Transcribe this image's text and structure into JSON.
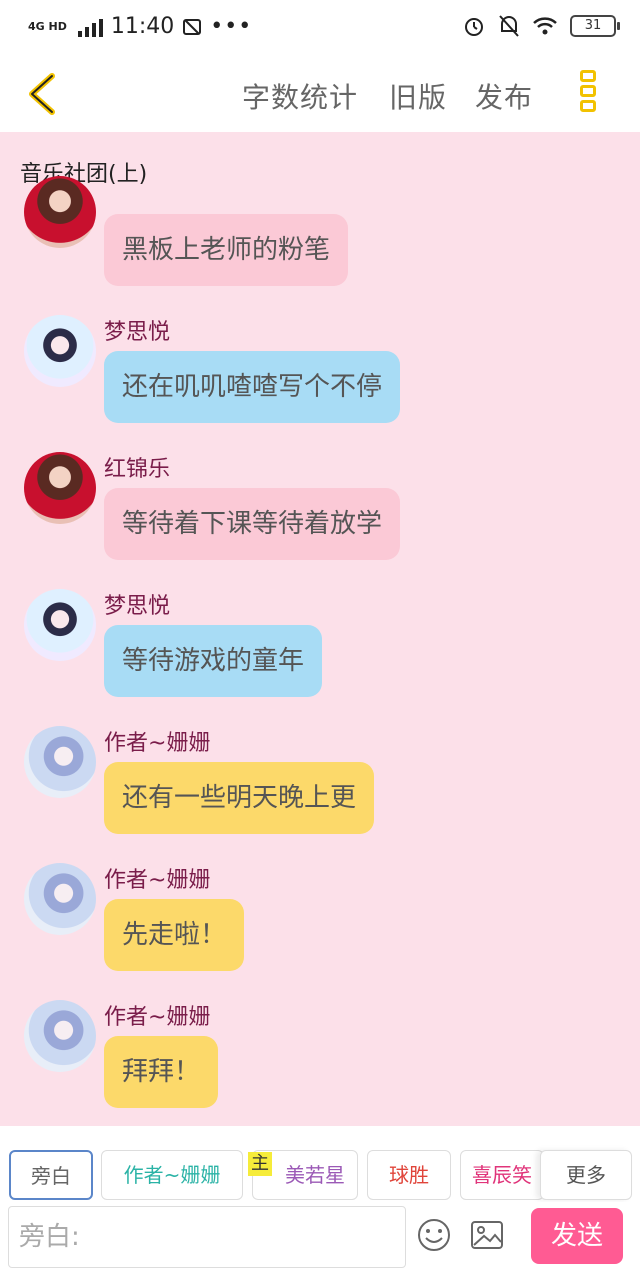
{
  "status_bar": {
    "network": "4G HD",
    "time": "11:40",
    "battery": "31"
  },
  "header": {
    "word_count": "字数统计",
    "old_version": "旧版",
    "publish": "发布"
  },
  "chat": {
    "title": "音乐社团(上)",
    "messages": [
      {
        "name": "",
        "text": "黑板上老师的粉笔",
        "style": "pink",
        "avatar": "red"
      },
      {
        "name": "梦思悦",
        "text": "还在叽叽喳喳写个不停",
        "style": "blue",
        "avatar": "blue"
      },
      {
        "name": "红锦乐",
        "text": "等待着下课等待着放学",
        "style": "pink",
        "avatar": "red"
      },
      {
        "name": "梦思悦",
        "text": "等待游戏的童年",
        "style": "blue",
        "avatar": "blue"
      },
      {
        "name": "作者~姗姗",
        "text": "还有一些明天晚上更",
        "style": "yellow",
        "avatar": "author"
      },
      {
        "name": "作者~姗姗",
        "text": "先走啦！",
        "style": "yellow",
        "avatar": "author"
      },
      {
        "name": "作者~姗姗",
        "text": "拜拜！",
        "style": "yellow",
        "avatar": "author"
      }
    ]
  },
  "roles": {
    "items": [
      {
        "label": "旁白",
        "color": "#666666"
      },
      {
        "label": "作者~姗姗",
        "color": "#2bb3a6"
      },
      {
        "label": "美若星",
        "color": "#9b59b6"
      },
      {
        "label": "球胜",
        "color": "#e0443a"
      },
      {
        "label": "喜辰笑",
        "color": "#e0347a"
      }
    ],
    "main_tag": "主",
    "more": "更多"
  },
  "input": {
    "placeholder": "旁白:",
    "send": "发送",
    "emoji_icon": "smiley-icon",
    "image_icon": "image-icon"
  },
  "colors": {
    "chat_bg": "#fce0e9",
    "pink_bubble": "#fbc9d6",
    "blue_bubble": "#a8dcf5",
    "yellow_bubble": "#fcd96a",
    "send_button": "#ff5b93",
    "accent_yellow": "#f2c200"
  }
}
